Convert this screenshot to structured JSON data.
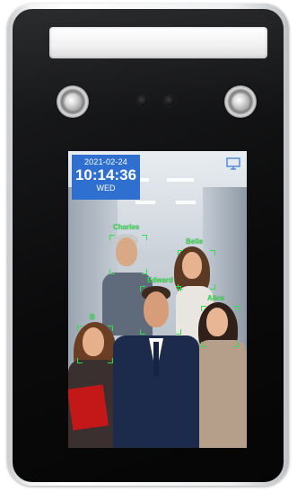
{
  "screen": {
    "date": "2021-02-24",
    "time": "10:14:36",
    "weekday": "WED",
    "faces": [
      {
        "name": "Charles"
      },
      {
        "name": "Belle"
      },
      {
        "name": "Edward"
      },
      {
        "name": "Alice"
      },
      {
        "name": "B"
      }
    ]
  },
  "colors": {
    "time_box": "#2f6fd0",
    "face_frame": "#2ee04a",
    "bezel": "#0b0b0c"
  },
  "icons": {
    "top_right": "monitor-icon"
  }
}
